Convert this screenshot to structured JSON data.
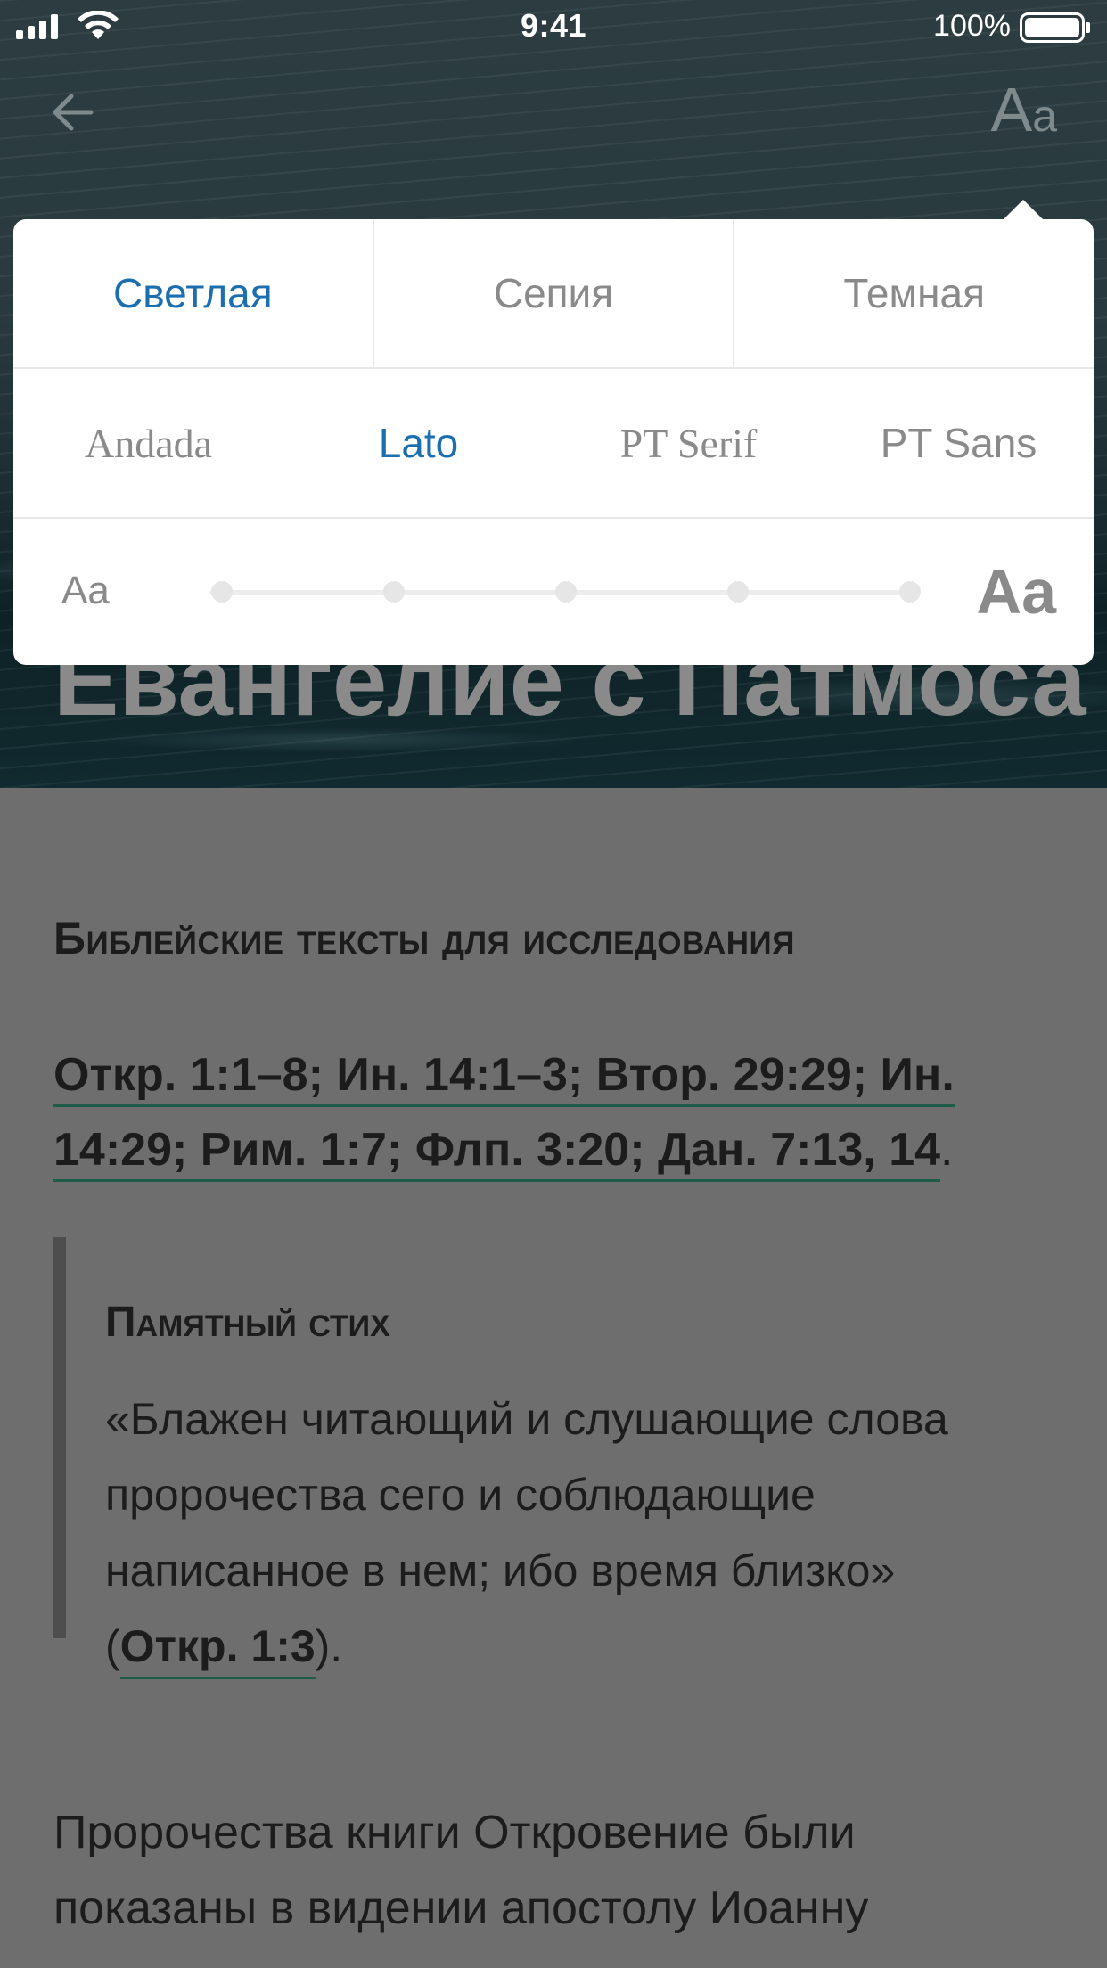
{
  "status_bar": {
    "time": "9:41",
    "battery": "100%",
    "icons": [
      "signal-icon",
      "wifi-icon",
      "battery-icon"
    ]
  },
  "nav": {
    "back_icon": "arrow-left-icon",
    "font_toggle_big": "A",
    "font_toggle_small": "a"
  },
  "hero": {
    "title": "Евангелие с Патмоса"
  },
  "settings": {
    "themes": [
      "Светлая",
      "Сепия",
      "Темная"
    ],
    "active_theme": "Светлая",
    "fonts": [
      "Andada",
      "Lato",
      "PT Serif",
      "PT Sans"
    ],
    "active_font": "Lato",
    "size_small_label": "Aa",
    "size_large_label": "Aa",
    "size_steps": 5
  },
  "article": {
    "section_heading": "Библейские тексты для исследования",
    "refs_line1": "Откр. 1:1–8; Ин. 14:1–3; Втор. 29:29; Ин.",
    "refs_line2": "14:29; Рим. 1:7; Флп. 3:20; Дан. 7:13, 14",
    "refs_tail": ".",
    "memory_title": "Памятный стих",
    "memory_text": "«Блажен читающий и слушающие слова пророчества сего и соблюдающие написанное в нем; ибо время близко» (",
    "memory_ref": "Откр. 1:3",
    "memory_tail": ").",
    "paragraph": "Пророчества книги Откровение были показаны в видении апостолу Иоанну"
  },
  "colors": {
    "accent": "#1b6fb0",
    "link_underline": "#1d5c48",
    "popover_bg": "#ffffff",
    "content_bg": "#6e6e6e"
  }
}
